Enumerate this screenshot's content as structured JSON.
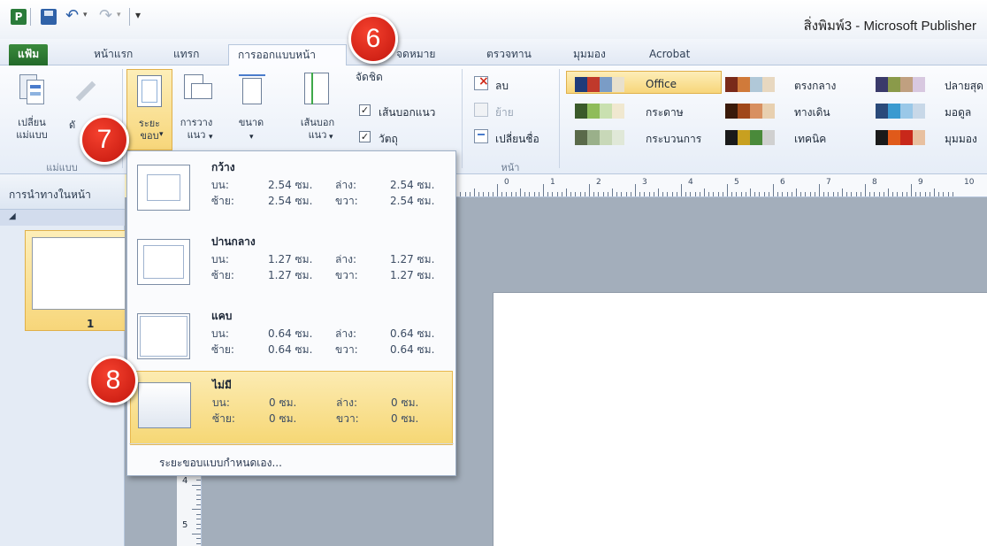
{
  "titlebar": {
    "title": "สิ่งพิมพ์3 - Microsoft Publisher"
  },
  "tabs": [
    {
      "label": "แฟ้ม"
    },
    {
      "label": "หน้าแรก"
    },
    {
      "label": "แทรก"
    },
    {
      "label": "การออกแบบหน้า"
    },
    {
      "label": "จดหมาย"
    },
    {
      "label": "ตรวจทาน"
    },
    {
      "label": "มุมมอง"
    },
    {
      "label": "Acrobat"
    }
  ],
  "ribbon": {
    "change_template": "เปลี่ยน\nแม่แบบ",
    "margins": "ระยะ\nขอบ",
    "orientation": "การวาง\nแนว",
    "size": "ขนาด",
    "guides": "เส้นบอก\nแนว",
    "template_group": "แม่แบบ",
    "align_label": "จัดชิด",
    "guides_check": "เส้นบอกแนว",
    "objects_check": "วัตถุ",
    "delete": "ลบ",
    "move": "ย้าย",
    "rename": "เปลี่ยนชื่อ",
    "pages_group": "หน้า",
    "schemes": [
      {
        "name": "Office",
        "colors": [
          "#1f3b7a",
          "#c0392b",
          "#7a9cc6",
          "#e8e0cc"
        ]
      },
      {
        "name": "กระดาษ",
        "colors": [
          "#3b5a2a",
          "#8fbc5a",
          "#c9e0b0",
          "#f0e8d0"
        ]
      },
      {
        "name": "กระบวนการ",
        "colors": [
          "#5a6a4a",
          "#9ab08a",
          "#c8d8b8",
          "#e0e8d8"
        ]
      },
      {
        "name": "ตรงกลาง",
        "colors": [
          "#7a2a1a",
          "#d07a3a",
          "#b0c8d8",
          "#e8d8c0"
        ]
      },
      {
        "name": "ทางเดิน",
        "colors": [
          "#3a1a0a",
          "#a0481a",
          "#d89060",
          "#e8d0b0"
        ]
      },
      {
        "name": "เทคนิค",
        "colors": [
          "#1a1a1a",
          "#c8a020",
          "#4a8a3a",
          "#d0d0d0"
        ]
      },
      {
        "name": "ปลายสุด",
        "colors": [
          "#3a3a6a",
          "#8a9a4a",
          "#c0a080",
          "#d8c8e0"
        ]
      },
      {
        "name": "มอดูล",
        "colors": [
          "#2a4a7a",
          "#3a9ad0",
          "#9ac8e8",
          "#c8d8e8"
        ]
      },
      {
        "name": "มุมมอง",
        "colors": [
          "#1a1a1a",
          "#e05a1a",
          "#c8281a",
          "#e8c0a0"
        ]
      }
    ]
  },
  "navpane": {
    "title": "การนำทางในหน้า",
    "page_number": "1"
  },
  "ruler_marks": [
    "0",
    "1",
    "2",
    "3",
    "4",
    "5",
    "6",
    "7",
    "8",
    "9",
    "10"
  ],
  "vruler_marks": [
    "4",
    "5"
  ],
  "margins_menu": {
    "options": [
      {
        "name": "กว้าง",
        "top_label": "บน:",
        "top": "2.54 ซม.",
        "bottom_label": "ล่าง:",
        "bottom": "2.54 ซม.",
        "left_label": "ซ้าย:",
        "left": "2.54 ซม.",
        "right_label": "ขวา:",
        "right": "2.54 ซม."
      },
      {
        "name": "ปานกลาง",
        "top_label": "บน:",
        "top": "1.27 ซม.",
        "bottom_label": "ล่าง:",
        "bottom": "1.27 ซม.",
        "left_label": "ซ้าย:",
        "left": "1.27 ซม.",
        "right_label": "ขวา:",
        "right": "1.27 ซม."
      },
      {
        "name": "แคบ",
        "top_label": "บน:",
        "top": "0.64 ซม.",
        "bottom_label": "ล่าง:",
        "bottom": "0.64 ซม.",
        "left_label": "ซ้าย:",
        "left": "0.64 ซม.",
        "right_label": "ขวา:",
        "right": "0.64 ซม."
      },
      {
        "name": "ไม่มี",
        "top_label": "บน:",
        "top": "0 ซม.",
        "bottom_label": "ล่าง:",
        "bottom": "0 ซม.",
        "left_label": "ซ้าย:",
        "left": "0 ซม.",
        "right_label": "ขวา:",
        "right": "0 ซม."
      }
    ],
    "custom": "ระยะขอบแบบกำหนดเอง..."
  },
  "callouts": [
    "6",
    "7",
    "8"
  ],
  "colors": {
    "accent_red": "#d8221a",
    "highlight": "#f6d774",
    "file_tab": "#2e7d32"
  }
}
